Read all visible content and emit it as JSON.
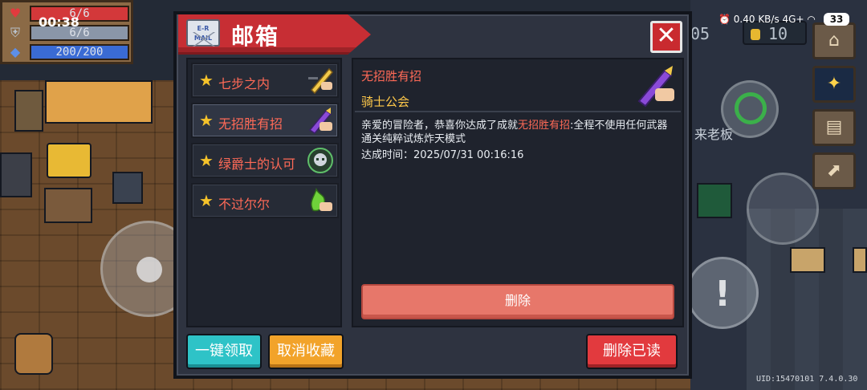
{
  "status_bar": {
    "time": "00:38",
    "net_speed": "0.40 KB/s",
    "signal": "4G+",
    "battery": "33"
  },
  "hud": {
    "health": {
      "text": "6/6",
      "value": 6,
      "max": 6,
      "color": "#d3383a"
    },
    "armor": {
      "text": "6/6",
      "value": 6,
      "max": 6,
      "color": "#8a96a8"
    },
    "energy": {
      "text": "200/200",
      "value": 200,
      "max": 200,
      "color": "#3a6bd4"
    }
  },
  "top_right": {
    "partial_number": "05",
    "coins": "10"
  },
  "npc_sign_text": "来老板",
  "mailbox": {
    "title": "邮箱",
    "icon_text": "E-R MAIL",
    "close_label": "✕",
    "items": [
      {
        "label": "七步之内",
        "thumb": "golden-sword-icon"
      },
      {
        "label": "无招胜有招",
        "thumb": "purple-sword-icon",
        "selected": true
      },
      {
        "label": "绿爵士的认可",
        "thumb": "green-knight-skull-icon"
      },
      {
        "label": "不过尔尔",
        "thumb": "green-flame-hand-icon"
      }
    ],
    "detail": {
      "title": "无招胜有招",
      "sender": "骑士公会",
      "body_prefix": "亲爱的冒险者，恭喜你达成了成就",
      "body_highlight": "无招胜有招",
      "body_suffix": ":全程不使用任何武器通关纯粹试炼炸天模式",
      "time": "达成时间：2025/07/31 00:16:16",
      "delete_label": "删除"
    },
    "buttons": {
      "claim_all": "一键领取",
      "unfavorite": "取消收藏",
      "delete_read": "删除已读"
    }
  },
  "uid_text": "UID:15470101 7.4.0.30"
}
